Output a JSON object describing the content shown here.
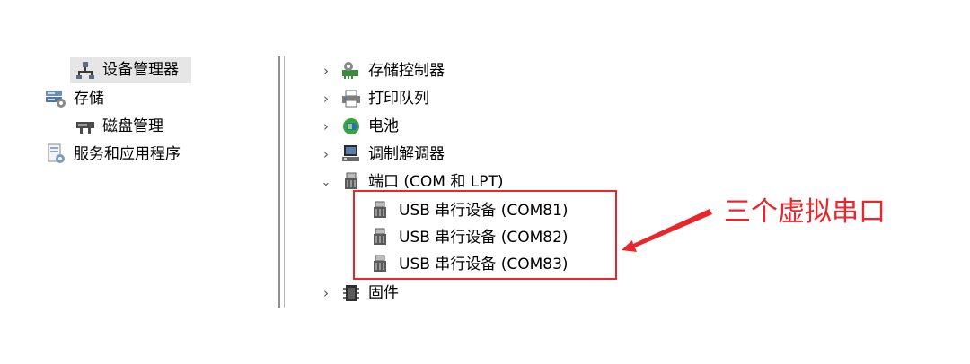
{
  "left_tree": {
    "items": [
      {
        "label": "设备管理器",
        "icon": "device-manager-icon",
        "selected": true
      },
      {
        "label": "存储",
        "icon": "storage-icon"
      },
      {
        "label": "磁盘管理",
        "icon": "disk-management-icon"
      },
      {
        "label": "服务和应用程序",
        "icon": "services-apps-icon"
      }
    ]
  },
  "device_tree": {
    "items": [
      {
        "label": "存储控制器",
        "icon": "storage-controller-icon",
        "expanded": false
      },
      {
        "label": "打印队列",
        "icon": "print-queue-icon",
        "expanded": false
      },
      {
        "label": "电池",
        "icon": "battery-icon",
        "expanded": false
      },
      {
        "label": "调制解调器",
        "icon": "modem-icon",
        "expanded": false
      },
      {
        "label": "端口 (COM 和 LPT)",
        "icon": "port-icon",
        "expanded": true,
        "children": [
          {
            "label": "USB 串行设备 (COM81)",
            "icon": "port-icon"
          },
          {
            "label": "USB 串行设备 (COM82)",
            "icon": "port-icon"
          },
          {
            "label": "USB 串行设备 (COM83)",
            "icon": "port-icon"
          }
        ]
      },
      {
        "label": "固件",
        "icon": "firmware-icon",
        "expanded": false
      }
    ]
  },
  "annotation": {
    "text": "三个虚拟串口",
    "color": "#e8262b"
  },
  "colors": {
    "selection": "#e6e6e6",
    "accent_red": "#e8262b",
    "divider": "#8f8f8f"
  }
}
